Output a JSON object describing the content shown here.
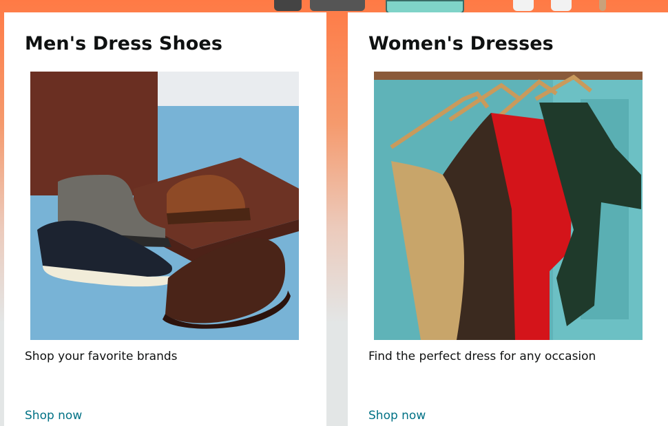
{
  "cards": [
    {
      "title": "Men's Dress Shoes",
      "image_alt": "Men's dress shoes and boots",
      "description": "Shop your favorite brands",
      "cta": "Shop now"
    },
    {
      "title": "Women's Dresses",
      "image_alt": "Women's dresses on hangers",
      "description": "Find the perfect dress for any occasion",
      "cta": "Shop now"
    }
  ],
  "colors": {
    "link": "#007185",
    "text": "#0f1111",
    "hero_top": "#ff7a45",
    "page_bg": "#e3e6e6"
  }
}
